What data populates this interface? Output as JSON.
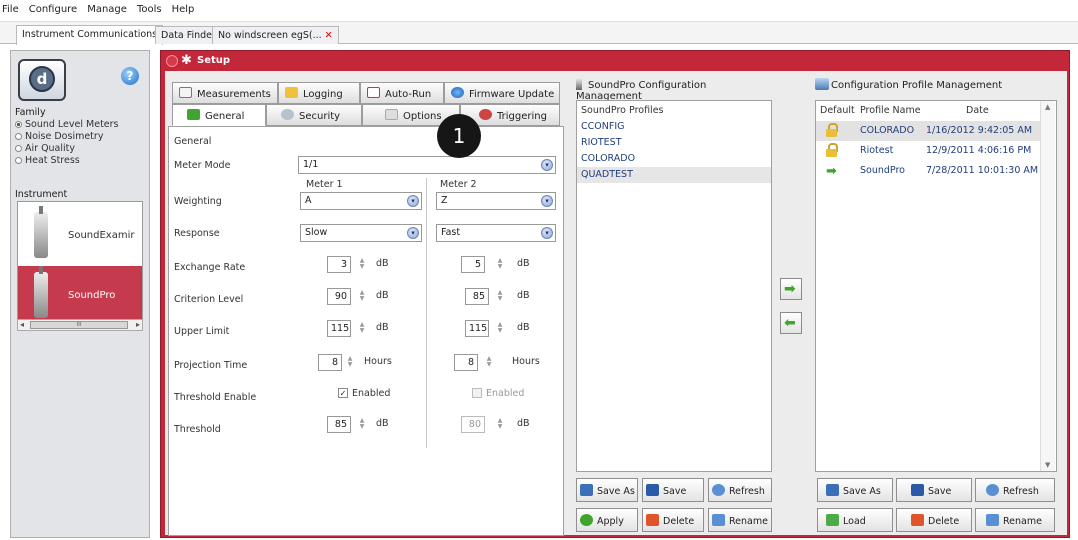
{
  "menubar": {
    "items": [
      "File",
      "Configure",
      "Manage",
      "Tools",
      "Help"
    ]
  },
  "doc_tabs": [
    {
      "label": "Instrument Communications"
    },
    {
      "label": "Data Finder"
    },
    {
      "label": "No windscreen egS(..."
    }
  ],
  "left": {
    "family_label": "Family",
    "families": [
      "Sound Level Meters",
      "Noise Dosimetry",
      "Air Quality",
      "Heat Stress"
    ],
    "selected_family": "Sound Level Meters",
    "instrument_label": "Instrument",
    "instruments": [
      "SoundExamir",
      "SoundPro"
    ],
    "scroll_thumb_text": "III"
  },
  "setup": {
    "title": "Setup",
    "tabs_row1": [
      "Measurements",
      "Logging",
      "Auto-Run",
      "Firmware Update"
    ],
    "tabs_row2": [
      "General",
      "Security",
      "Options",
      "Triggering"
    ],
    "active_tab": "General",
    "section_title": "General",
    "meter_mode_label": "Meter Mode",
    "meter_mode_value": "1/1",
    "meter1_label": "Meter 1",
    "meter2_label": "Meter 2",
    "weighting_label": "Weighting",
    "weighting": [
      "A",
      "Z"
    ],
    "response_label": "Response",
    "response": [
      "Slow",
      "Fast"
    ],
    "exchange_rate_label": "Exchange Rate",
    "exchange_rate": [
      "3",
      "5"
    ],
    "criterion_label": "Criterion Level",
    "criterion": [
      "90",
      "85"
    ],
    "upper_limit_label": "Upper Limit",
    "upper_limit": [
      "115",
      "115"
    ],
    "projection_label": "Projection Time",
    "projection": [
      "8",
      "8"
    ],
    "threshold_enable_label": "Threshold Enable",
    "threshold_enabled_text": "Enabled",
    "threshold_enabled": [
      true,
      false
    ],
    "threshold_label": "Threshold",
    "threshold": [
      "85",
      "80"
    ],
    "unit_db": "dB",
    "unit_hours": "Hours",
    "callout": "1"
  },
  "soundpro_cm": {
    "title": "SoundPro Configuration Management",
    "list_header": "SoundPro Profiles",
    "profiles": [
      "CCONFIG",
      "RIOTEST",
      "COLORADO",
      "QUADTEST"
    ],
    "selected": "QUADTEST",
    "buttons": [
      "Save As",
      "Save",
      "Refresh",
      "Apply",
      "Delete",
      "Rename"
    ]
  },
  "profile_mgmt": {
    "title": "Configuration Profile Management",
    "headers": [
      "Default",
      "Profile Name",
      "Date"
    ],
    "rows": [
      {
        "name": "COLORADO",
        "date": "1/16/2012 9:42:05 AM",
        "icon": "lock-icon"
      },
      {
        "name": "Riotest",
        "date": "12/9/2011 4:06:16 PM",
        "icon": "lock-icon"
      },
      {
        "name": "SoundPro",
        "date": "7/28/2011 10:01:30 AM",
        "icon": "green-arrow-icon"
      }
    ],
    "buttons": [
      "Save As",
      "Save",
      "Refresh",
      "Load",
      "Delete",
      "Rename"
    ]
  }
}
